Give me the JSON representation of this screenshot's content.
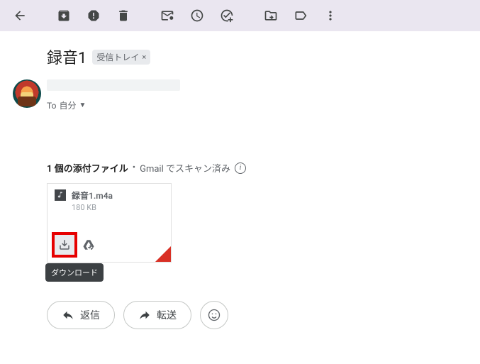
{
  "subject": "録音1",
  "inbox_chip": "受信トレイ",
  "recipients": {
    "prefix": "To",
    "target": "自分"
  },
  "attachments_header": {
    "count_label": "1 個の添付ファイル",
    "scan_label": "Gmail でスキャン済み"
  },
  "attachment": {
    "filename": "録音1.m4a",
    "size": "180 KB",
    "download_tooltip": "ダウンロード"
  },
  "actions": {
    "reply": "返信",
    "forward": "転送"
  }
}
